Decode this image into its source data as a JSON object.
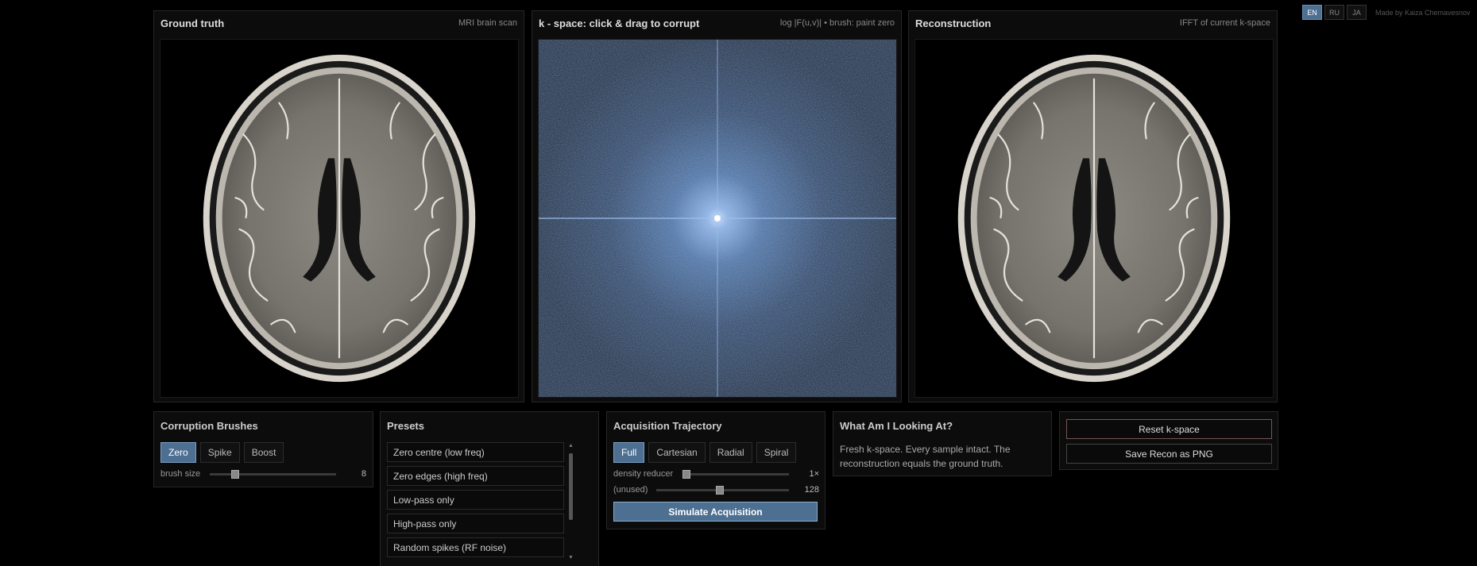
{
  "lang": {
    "options": [
      "EN",
      "RU",
      "JA"
    ],
    "active": "EN",
    "credit": "Made by Kaiza Chemavesnov"
  },
  "panels": {
    "ground_truth": {
      "title": "Ground truth",
      "subtitle": "MRI brain scan"
    },
    "kspace": {
      "title": "k - space: click & drag to corrupt",
      "subtitle": "log |F(u,v)|  •  brush: paint zero"
    },
    "recon": {
      "title": "Reconstruction",
      "subtitle": "IFFT of current k-space"
    }
  },
  "brushes": {
    "title": "Corruption Brushes",
    "options": [
      "Zero",
      "Spike",
      "Boost"
    ],
    "active": "Zero",
    "size_label": "brush size",
    "size_value": "8",
    "size_fraction": 0.2
  },
  "presets": {
    "title": "Presets",
    "items": [
      "Zero centre (low freq)",
      "Zero edges (high freq)",
      "Low-pass only",
      "High-pass only",
      "Random spikes (RF noise)"
    ]
  },
  "acquisition": {
    "title": "Acquisition Trajectory",
    "options": [
      "Full",
      "Cartesian",
      "Radial",
      "Spiral"
    ],
    "active": "Full",
    "density_label": "density reducer",
    "density_value": "1×",
    "density_fraction": 0.0,
    "unused_label": "(unused)",
    "unused_value": "128",
    "unused_fraction": 0.48,
    "simulate_label": "Simulate Acquisition"
  },
  "info": {
    "title": "What Am I Looking At?",
    "text": "Fresh k-space. Every sample intact. The reconstruction equals the ground truth."
  },
  "actions": {
    "reset_label": "Reset k-space",
    "save_label": "Save Recon as PNG"
  }
}
